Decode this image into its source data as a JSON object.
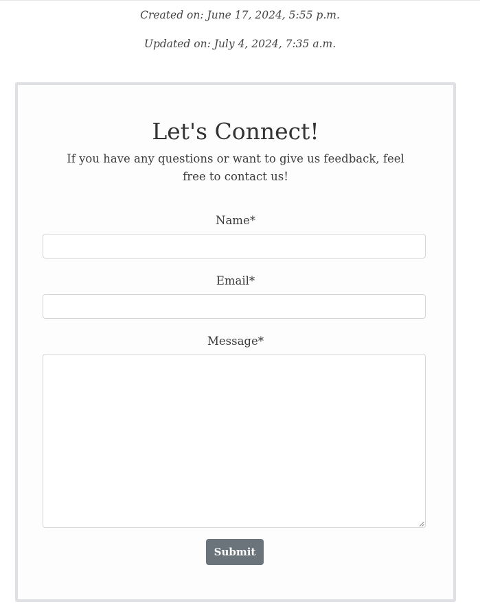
{
  "meta": {
    "created": "Created on: June 17, 2024, 5:55 p.m.",
    "updated": "Updated on: July 4, 2024, 7:35 a.m."
  },
  "contact": {
    "heading": "Let's Connect!",
    "subtext": "If you have any questions or want to give us feedback, feel free to contact us!",
    "fields": {
      "name_label": "Name*",
      "name_value": "",
      "email_label": "Email*",
      "email_value": "",
      "message_label": "Message*",
      "message_value": ""
    },
    "submit_label": "Submit"
  },
  "colors": {
    "card_border": "#dee0e4",
    "button_bg": "#6b737b",
    "button_text": "#ffffff",
    "text": "#3b3b3b"
  }
}
